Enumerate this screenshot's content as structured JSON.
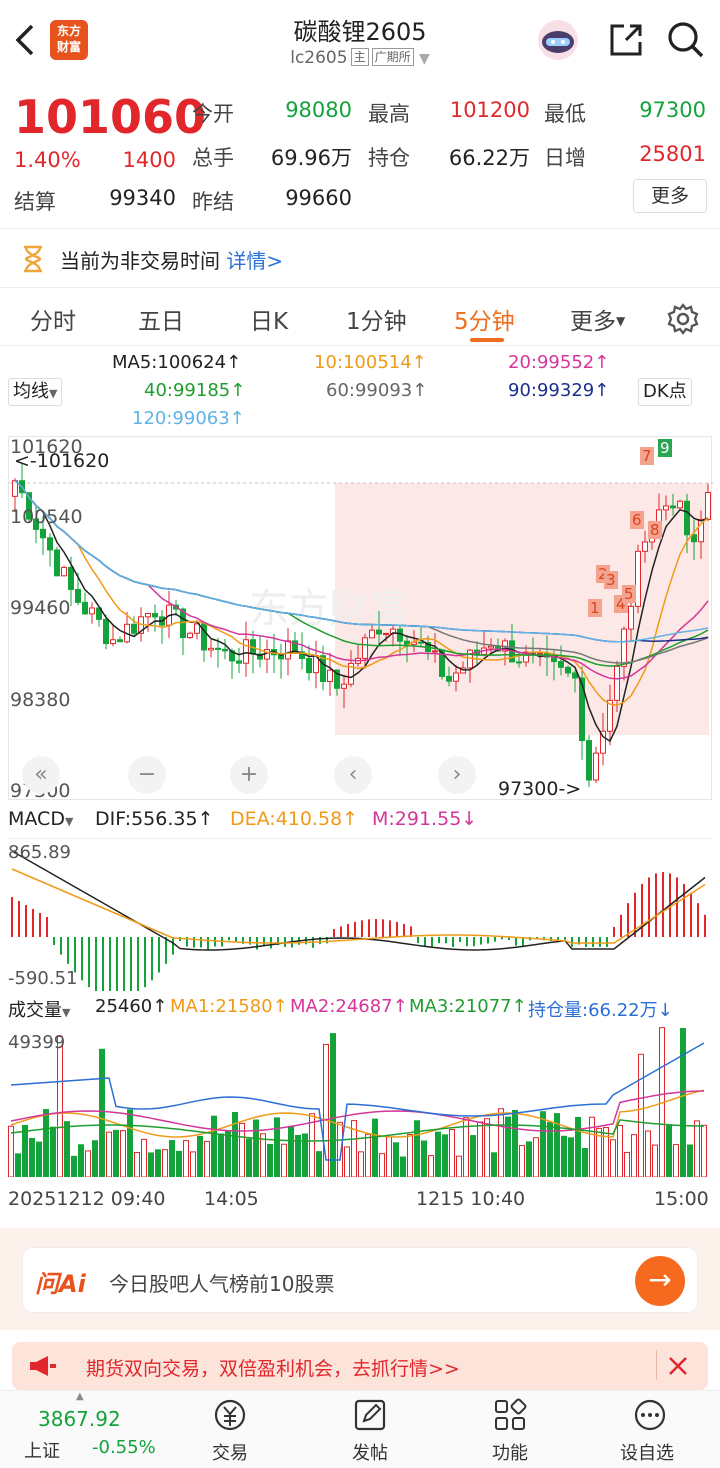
{
  "header": {
    "back_icon": "chevron-left-icon",
    "logo_text_line1": "东方",
    "logo_text_line2": "财富",
    "title": "碳酸锂2605",
    "code": "lc2605",
    "tag_main": "主",
    "tag_exchange": "广期所",
    "share_icon": "share-icon",
    "search_icon": "search-icon",
    "avatar_icon": "robot-avatar-icon"
  },
  "quote": {
    "price": "101060",
    "change_pct": "1.40%",
    "change": "1400",
    "open_label": "今开",
    "open": "98080",
    "high_label": "最高",
    "high": "101200",
    "low_label": "最低",
    "low": "97300",
    "volume_label": "总手",
    "volume": "69.96万",
    "oi_label": "持仓",
    "oi": "66.22万",
    "daily_inc_label": "日增",
    "daily_inc": "25801",
    "settle_label": "结算",
    "settle": "99340",
    "prev_settle_label": "昨结",
    "prev_settle": "99660",
    "more_label": "更多"
  },
  "notice": {
    "icon": "hourglass-icon",
    "text": "当前为非交易时间",
    "link": "详情>"
  },
  "tabs": [
    "分时",
    "五日",
    "日K",
    "1分钟",
    "5分钟",
    "更多"
  ],
  "active_tab": "5分钟",
  "settings_icon": "gear-icon",
  "ma": {
    "selector": "均线",
    "ma5": "MA5:100624↑",
    "ma10": "10:100514↑",
    "ma20": "20:99552↑",
    "ma40": "40:99185↑",
    "ma60": "60:99093↑",
    "ma90": "90:99329↑",
    "ma120": "120:99063↑",
    "dk_button": "DK点"
  },
  "main_chart": {
    "y_labels": [
      "101620",
      "100540",
      "99460",
      "98380",
      "97300"
    ],
    "high_marker": "<-101620",
    "low_marker": "97300->",
    "signal_numbers": [
      "1",
      "2",
      "3",
      "4",
      "5",
      "6",
      "7",
      "8",
      "9"
    ],
    "colors": {
      "up": "#e1272b",
      "down": "#14a33a",
      "ma5": "#222222",
      "ma10": "#f09a18",
      "ma20": "#d4369a",
      "ma40": "#1f9e2f",
      "ma60": "#777777",
      "ma90": "#1c2f8c",
      "ma120": "#5fb3e6"
    }
  },
  "macd": {
    "selector": "MACD",
    "dif": "DIF:556.35↑",
    "dea": "DEA:410.58↑",
    "m": "M:291.55↓",
    "y_top": "865.89",
    "y_bottom": "-590.51"
  },
  "volume": {
    "selector": "成交量",
    "vol": "25460↑",
    "ma1": "MA1:21580↑",
    "ma2": "MA2:24687↑",
    "ma3": "MA3:21077↑",
    "oi": "持仓量:66.22万↓",
    "y_top": "49399"
  },
  "x_labels": [
    "20251212 09:40",
    "14:05",
    "1215 10:40",
    "15:00"
  ],
  "ai": {
    "logo": "问Ai",
    "text": "今日股吧人气榜前10股票",
    "go_icon": "arrow-right-icon"
  },
  "promo": {
    "icon": "megaphone-icon",
    "text": "期货双向交易，双倍盈利机会，去抓行情>>",
    "close_icon": "close-icon"
  },
  "bottom_nav": {
    "index_value": "3867.92",
    "index_name": "上证",
    "index_change": "-0.55%",
    "items": [
      "交易",
      "发帖",
      "功能",
      "设自选"
    ]
  }
}
